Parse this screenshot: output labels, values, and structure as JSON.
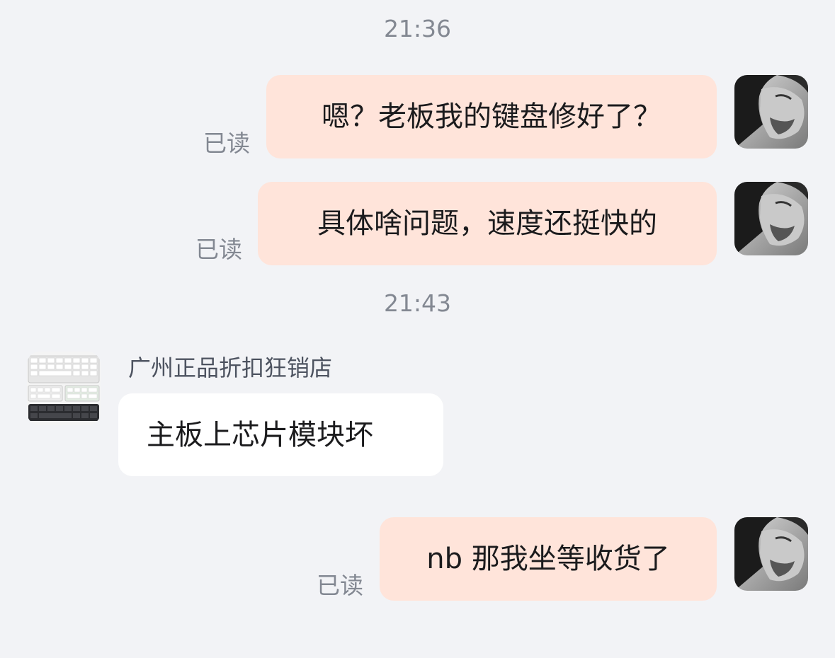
{
  "conversation": {
    "timestamps": [
      "21:36",
      "21:43"
    ],
    "messages": [
      {
        "from": "me",
        "text": "嗯？老板我的键盘修好了？",
        "status": "已读",
        "avatar": "user-portrait-avatar"
      },
      {
        "from": "me",
        "text": "具体啥问题，速度还挺快的",
        "status": "已读",
        "avatar": "user-portrait-avatar"
      },
      {
        "from": "shop",
        "sender": "广州正品折扣狂销店",
        "text": "主板上芯片模块坏",
        "avatar": "keyboard-product-avatar"
      },
      {
        "from": "me",
        "text": "nb 那我坐等收货了",
        "status": "已读",
        "avatar": "user-portrait-avatar"
      }
    ]
  },
  "colors": {
    "background": "#f2f3f6",
    "my_bubble": "#ffe4da",
    "their_bubble": "#ffffff",
    "meta_text": "#838892"
  }
}
